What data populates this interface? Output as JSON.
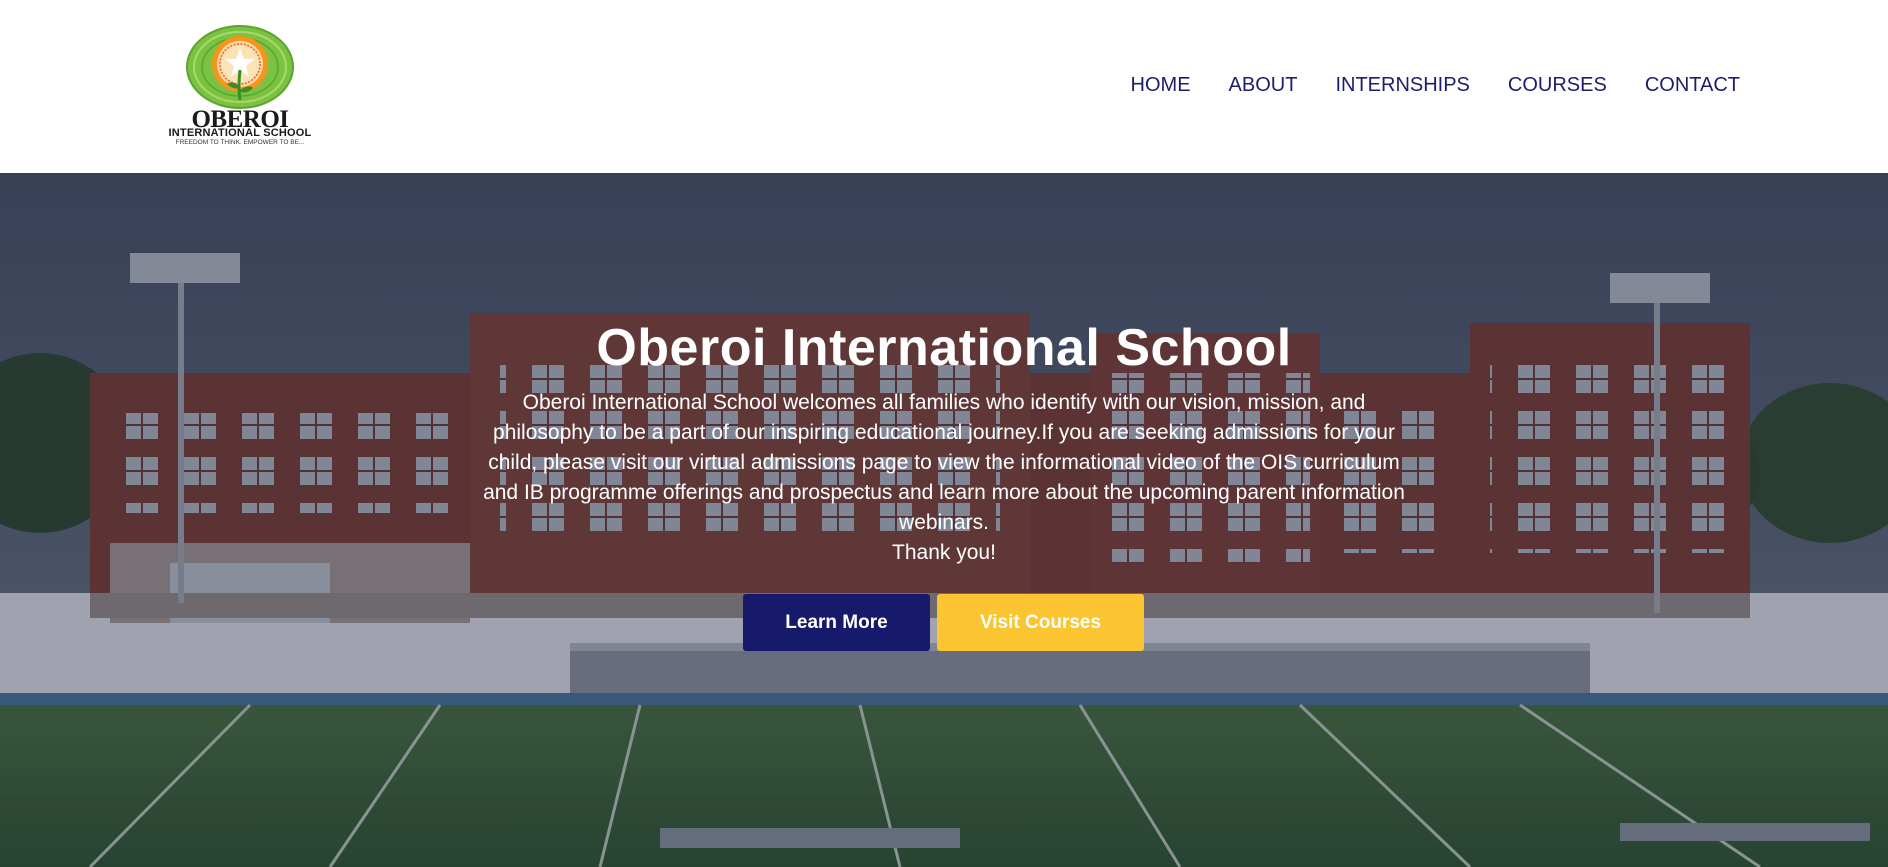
{
  "logo": {
    "name": "OBEROI",
    "subtitle": "INTERNATIONAL SCHOOL",
    "tagline": "FREEDOM TO THINK. EMPOWER TO BE..."
  },
  "nav": {
    "items": [
      {
        "label": "HOME"
      },
      {
        "label": "ABOUT"
      },
      {
        "label": "INTERNSHIPS"
      },
      {
        "label": "COURSES"
      },
      {
        "label": "CONTACT"
      }
    ]
  },
  "hero": {
    "title": "Oberoi International School",
    "description": "Oberoi International School welcomes all families who identify with our vision, mission, and philosophy to be a part of our inspiring educational journey.If you are seeking admissions for your child, please visit our virtual admissions page to view the informational video of the OIS curriculum and IB programme offerings and prospectus and learn more about the upcoming parent information webinars.",
    "thanks": "Thank you!",
    "primary_button": "Learn More",
    "secondary_button": "Visit Courses"
  },
  "colors": {
    "nav_text": "#1b1f6b",
    "primary_button": "#171a6b",
    "secondary_button": "#fbc531",
    "hero_text": "#ffffff"
  },
  "icons": {
    "logo_emblem": "sun-flower-emblem-icon"
  }
}
